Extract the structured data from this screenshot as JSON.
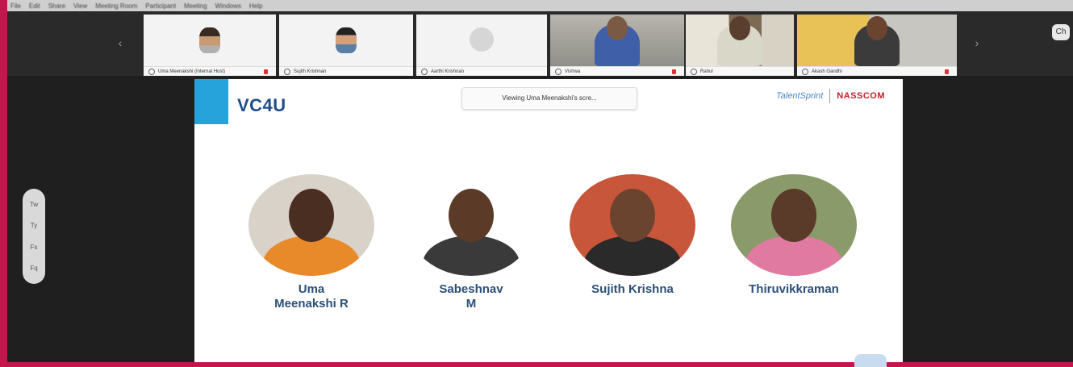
{
  "menu": {
    "items": [
      "File",
      "Edit",
      "Share",
      "View",
      "Meeting Room",
      "Participant",
      "Meeting",
      "Windows",
      "Help"
    ]
  },
  "participants": [
    {
      "caption": "Uma Meenakshi (Internal Host)"
    },
    {
      "caption": "Sujith Krishnan"
    },
    {
      "caption": "Aarthi Krishnan"
    },
    {
      "caption": "Vishwa"
    },
    {
      "caption": "Rahul"
    },
    {
      "caption": "Akash Gandhi"
    }
  ],
  "toolbar": {
    "chat_label": "Ch",
    "side_tools": [
      "Tw",
      "Ty",
      "Fs",
      "Fq"
    ]
  },
  "slide": {
    "title": "VC4U",
    "viewing_text": "Viewing Uma Meenakshi's scre...",
    "logo_left": "TalentSprint",
    "logo_right": "NASSCOM"
  },
  "team": [
    {
      "name": "Uma\nMeenakshi R"
    },
    {
      "name": "Sabeshnav\nM"
    },
    {
      "name": "Sujith Krishna"
    },
    {
      "name": "Thiruvikkraman"
    }
  ],
  "colors": {
    "border": "#c2164c",
    "accent_blue": "#27a3dc",
    "title_blue": "#1f4e8c",
    "name_blue": "#2c4f78"
  },
  "icons": [
    "chevron-left-icon",
    "chevron-right-icon",
    "mic-icon",
    "mic-muted-icon",
    "chat-icon"
  ]
}
